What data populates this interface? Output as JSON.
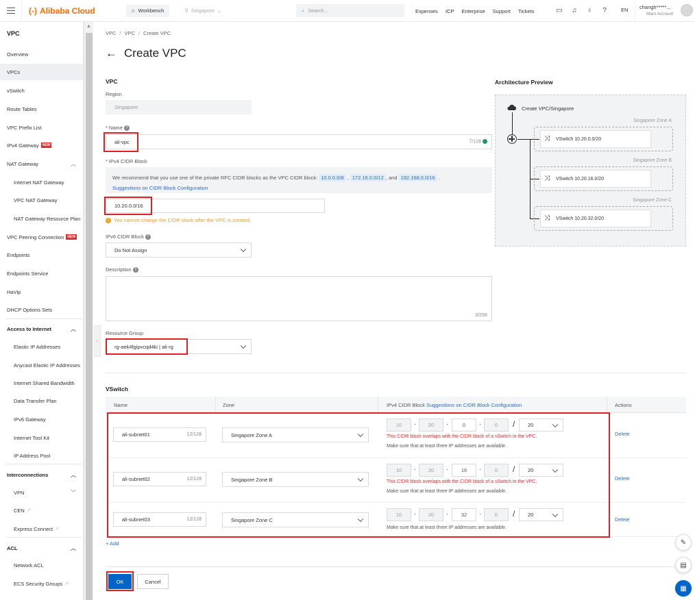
{
  "topbar": {
    "brand": "Alibaba Cloud",
    "workbench": "Workbench",
    "region": "Singapore",
    "search_placeholder": "Search...",
    "nav": [
      "Expenses",
      "ICP",
      "Enterprise",
      "Support",
      "Tickets"
    ],
    "lang": "EN",
    "account_name": "changh*****...",
    "account_type": "Main Account"
  },
  "sidebar": {
    "title": "VPC",
    "items": [
      {
        "label": "Overview"
      },
      {
        "label": "VPCs"
      },
      {
        "label": "vSwitch"
      },
      {
        "label": "Route Tables"
      },
      {
        "label": "VPC Prefix List"
      },
      {
        "label": "IPv4 Gateway",
        "badge": "NEW"
      },
      {
        "label": "NAT Gateway"
      },
      {
        "label": "Internet NAT Gateway"
      },
      {
        "label": "VPC NAT Gateway"
      },
      {
        "label": "NAT Gateway Resource Plan"
      },
      {
        "label": "VPC Peering Connection",
        "badge": "NEW"
      },
      {
        "label": "Endpoints"
      },
      {
        "label": "Endpoints Service"
      },
      {
        "label": "HaVip"
      },
      {
        "label": "DHCP Options Sets"
      },
      {
        "label": "Access to Internet"
      },
      {
        "label": "Elastic IP Addresses"
      },
      {
        "label": "Anycast Elastic IP Addresses"
      },
      {
        "label": "Internet Shared Bandwidth"
      },
      {
        "label": "Data Transfer Plan"
      },
      {
        "label": "IPv6 Gateway"
      },
      {
        "label": "Internet Tool Kit"
      },
      {
        "label": "IP Address Pool"
      },
      {
        "label": "Interconnections"
      },
      {
        "label": "VPN"
      },
      {
        "label": "CEN"
      },
      {
        "label": "Express Connect"
      },
      {
        "label": "ACL"
      },
      {
        "label": "Network ACL"
      },
      {
        "label": "ECS Security Groups"
      }
    ]
  },
  "breadcrumb": [
    "VPC",
    "VPC",
    "Create VPC"
  ],
  "page_title": "Create VPC",
  "vpc_section": {
    "title": "VPC",
    "region_label": "Region",
    "region_value": "Singapore",
    "name_label": "Name",
    "name_value": "ali-vpc",
    "name_counter": "7/128",
    "ipv4_label": "IPv4 CIDR Block",
    "notice_prefix": "We recommend that you use one of the private RFC CIDR blocks as the VPC CIDR block:",
    "notice_cidr1": "10.0.0.0/8",
    "notice_cidr2": "172.16.0.0/12",
    "notice_and": ", and",
    "notice_cidr3": "192.168.0.0/16",
    "notice_link": "Suggestions on CIDR Block Configuration",
    "ipv4_value": "10.20.0.0/16",
    "ipv4_warning": "You cannot change the CIDR block after the VPC is created.",
    "ipv6_label": "IPv6 CIDR Block",
    "ipv6_value": "Do Not Assign",
    "desc_label": "Description",
    "desc_counter": "0/256",
    "rg_label": "Resource Group",
    "rg_value": "rg-aek4fgipvcqd4ki | ali-rg"
  },
  "architecture": {
    "title": "Architecture Preview",
    "vpc_label": "Create VPC/Singapore",
    "zones": [
      {
        "zone": "Singapore Zone A",
        "vswitch": "VSwitch 10.20.0.0/20"
      },
      {
        "zone": "Singapore Zone B",
        "vswitch": "VSwitch 10.20.16.0/20"
      },
      {
        "zone": "Singapore Zone C",
        "vswitch": "VSwitch 10.20.32.0/20"
      }
    ]
  },
  "vswitch": {
    "title": "VSwitch",
    "headers": {
      "name": "Name",
      "zone": "Zone",
      "cidr": "IPv4 CIDR Block",
      "cidr_link": "Suggestions on CIDR Block Configuration",
      "actions": "Actions"
    },
    "rows": [
      {
        "name": "ali-subnet01",
        "counter": "12/128",
        "zone": "Singapore Zone A",
        "o1": "10",
        "o2": "20",
        "o3": "0",
        "o4": "0",
        "mask": "20",
        "error": "This CIDR block overlaps with the CIDR block of a vSwitch in the VPC.",
        "hint": "Make sure that at least three IP addresses are available.",
        "action": "Delete"
      },
      {
        "name": "ali-subnet02",
        "counter": "12/128",
        "zone": "Singapore Zone B",
        "o1": "10",
        "o2": "20",
        "o3": "16",
        "o4": "0",
        "mask": "20",
        "error": "This CIDR block overlaps with the CIDR block of a vSwitch in the VPC.",
        "hint": "Make sure that at least three IP addresses are available.",
        "action": "Delete"
      },
      {
        "name": "ali-subnet03",
        "counter": "12/128",
        "zone": "Singapore Zone C",
        "o1": "10",
        "o2": "20",
        "o3": "32",
        "o4": "0",
        "mask": "20",
        "error": "",
        "hint": "Make sure that at least three IP addresses are available.",
        "action": "Delete"
      }
    ],
    "add_label": "+ Add"
  },
  "footer": {
    "ok": "OK",
    "cancel": "Cancel"
  },
  "colors": {
    "brand": "#ff6a00",
    "primary": "#0064c8",
    "link": "#2a6bcf",
    "error": "#e02e2e",
    "warning": "#f0a020",
    "highlight": "#e02020"
  }
}
